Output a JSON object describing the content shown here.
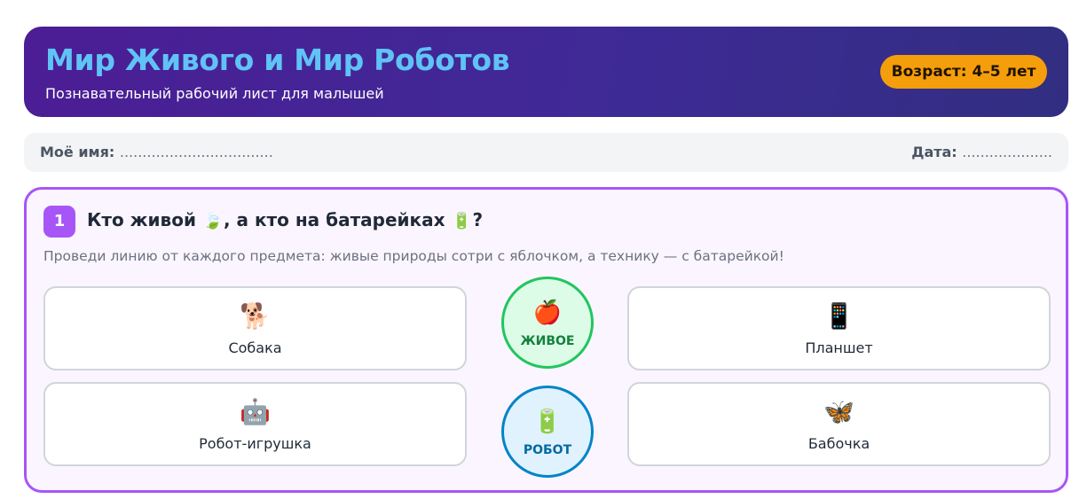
{
  "header": {
    "title": "Мир Живого и Мир Роботов",
    "subtitle": "Познавательный рабочий лист для малышей",
    "age_badge": "Возраст: 4–5 лет"
  },
  "namebar": {
    "name_label": "Моё имя:",
    "name_blank": "..................................",
    "date_label": "Дата:",
    "date_blank": "...................."
  },
  "task1": {
    "number": "1",
    "title_part1": "Кто живой",
    "title_icon1": "🍃",
    "title_part2": ", а кто на батарейках",
    "title_icon2": "🔋",
    "title_part3": "?",
    "description": "Проведи линию от каждого предмета: живые природы сотри с яблочком, а технику — с батарейкой!",
    "cards": {
      "dog": {
        "icon": "🐕",
        "label": "Собака"
      },
      "robot": {
        "icon": "🤖",
        "label": "Робот-игрушка"
      },
      "tablet": {
        "icon": "📱",
        "label": "Планшет"
      },
      "butterfly": {
        "icon": "🦋",
        "label": "Бабочка"
      }
    },
    "circles": {
      "alive": {
        "icon": "🍎",
        "label": "ЖИВОЕ"
      },
      "robot": {
        "icon": "🔋",
        "label": "РОБОТ"
      }
    }
  },
  "colors": {
    "header_gradient_start": "#4c1d95",
    "header_gradient_end": "#312e81",
    "title": "#60c3f5",
    "badge": "#f59e0b",
    "task_accent": "#a855f7",
    "alive_green": "#22c55e",
    "robot_blue": "#0284c7"
  }
}
